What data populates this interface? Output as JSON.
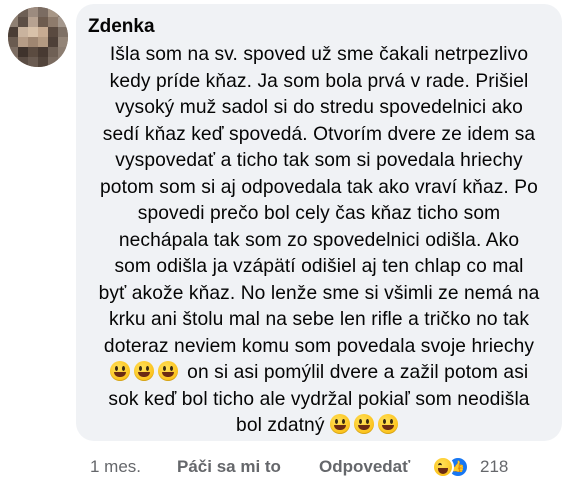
{
  "comment": {
    "author": "Zdenka",
    "lines": [
      "Išla som na sv. spoved už sme čakali netrpezlivo",
      "kedy príde kňaz. Ja som bola prvá v rade. Prišiel",
      "vysoký muž sadol si do stredu spovedelnici ako",
      "sedí kňaz keď spovedá. Otvorím dvere ze idem sa",
      "vyspovedať a ticho tak som si povedala hriechy",
      "potom som si aj odpovedala tak ako vraví kňaz. Po",
      "spovedi prečo bol cely čas kňaz ticho som",
      "nechápala tak som zo spovedelnici odišla. Ako",
      "som odišla ja vzápätí odišiel aj ten chlap co mal",
      "byť akože kňaz. No lenže sme si všimli ze nemá na",
      "krku ani štolu mal na sebe len rifle a tričko no tak",
      "doteraz neviem komu som povedala svoje hriechy"
    ],
    "line13_text": "on si asi pomýlil dvere a zažil potom asi",
    "line14": "sok keď bol ticho ale vydržal pokiaľ som neodišla",
    "line15_text": "bol zdatný",
    "emoji": "grinning-face-emoji"
  },
  "actions": {
    "time": "1 mes.",
    "like_label": "Páči sa mi to",
    "reply_label": "Odpovedať"
  },
  "reactions": {
    "icons": [
      "haha-reaction-icon",
      "like-reaction-icon"
    ],
    "count": "218",
    "like_color": "#1877f2"
  }
}
